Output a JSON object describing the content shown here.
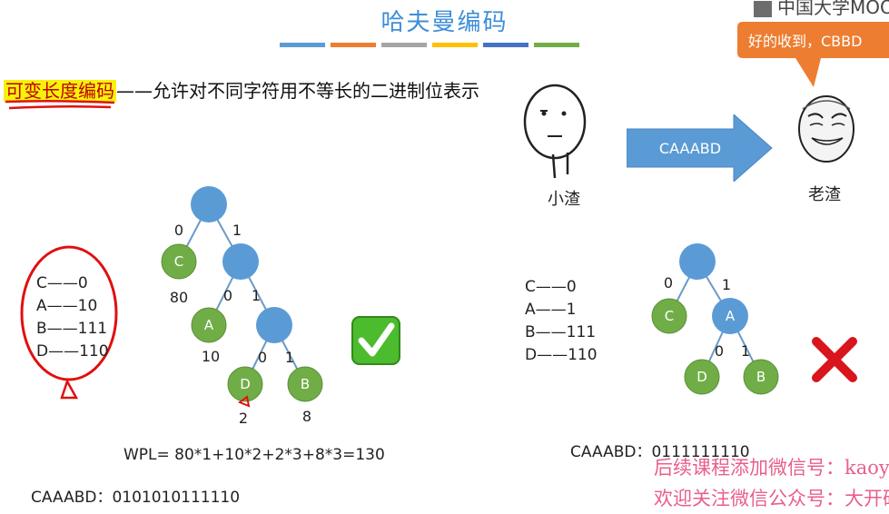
{
  "slide": {
    "title": "哈夫曼编码",
    "stripe_colors": [
      "#5b9bd5",
      "#ed7d31",
      "#a5a5a5",
      "#ffc000",
      "#4472c4",
      "#70ad47"
    ],
    "watermark": "中国大学MOOC",
    "subject_term": "可变长度编码",
    "subject_rest": "——允许对不同字符用不等长的二进制位表示"
  },
  "left_codes": [
    "C——0",
    "A——10",
    "B——111",
    "D——110"
  ],
  "left_tree": {
    "edge_labels": [
      "0",
      "1",
      "0",
      "1",
      "0",
      "1"
    ],
    "leaves": [
      {
        "char": "C",
        "weight": "80"
      },
      {
        "char": "A",
        "weight": "10"
      },
      {
        "char": "D",
        "weight": "2"
      },
      {
        "char": "B",
        "weight": "8"
      }
    ],
    "valid_icon": "check-mark-icon"
  },
  "wpl": "WPL= 80*1+10*2+2*3+8*3=130",
  "encoded_left": "CAAABD：0101010111110",
  "scene": {
    "sender_name": "小渣",
    "receiver_name": "老渣",
    "message": "CAAABD",
    "reply": "好的收到，CBBD"
  },
  "right_codes": [
    "C——0",
    "A——1",
    "B——111",
    "D——110"
  ],
  "right_tree": {
    "edge_labels": [
      "0",
      "1",
      "0",
      "1"
    ],
    "nodes": [
      "C",
      "A",
      "D",
      "B"
    ],
    "invalid_icon": "cross-mark-icon"
  },
  "encoded_right": "CAAABD：0111111110",
  "promo": {
    "line1": "后续课程添加微信号：kaoya",
    "line2": "欢迎关注微信公众号：大开研"
  },
  "colors": {
    "title": "#3e8ed8",
    "tree_internal": "#5b9bd5",
    "tree_leaf": "#70ad47",
    "bubble": "#ed7d31",
    "arrow": "#5b9bd5",
    "promo": "#e8608a",
    "highlight": "#f8f20a"
  }
}
